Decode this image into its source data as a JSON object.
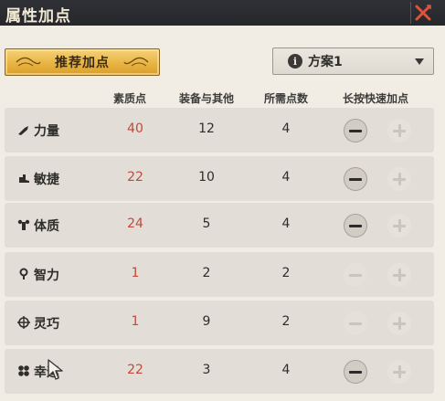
{
  "window": {
    "title": "属性加点",
    "close_icon": "close-icon"
  },
  "toolbar": {
    "recommend_label": "推荐加点",
    "scheme_label": "方案1",
    "scheme_info_glyph": "i"
  },
  "columns": {
    "base": "素质点",
    "equip": "装备与其他",
    "need": "所需点数",
    "quick_add": "长按快速加点"
  },
  "attributes": [
    {
      "name": "力量",
      "icon": "strength-icon",
      "base": "40",
      "equip": "12",
      "need": "4",
      "minus_enabled": true
    },
    {
      "name": "敏捷",
      "icon": "agility-icon",
      "base": "22",
      "equip": "10",
      "need": "4",
      "minus_enabled": true
    },
    {
      "name": "体质",
      "icon": "constitution-icon",
      "base": "24",
      "equip": "5",
      "need": "4",
      "minus_enabled": true
    },
    {
      "name": "智力",
      "icon": "intelligence-icon",
      "base": "1",
      "equip": "2",
      "need": "2",
      "minus_enabled": false
    },
    {
      "name": "灵巧",
      "icon": "dexterity-icon",
      "base": "1",
      "equip": "9",
      "need": "2",
      "minus_enabled": false
    },
    {
      "name": "幸运",
      "icon": "luck-icon",
      "base": "22",
      "equip": "3",
      "need": "4",
      "minus_enabled": true
    }
  ],
  "colors": {
    "base_value": "#c0493a",
    "title_bar": "#2f3136",
    "close_accent": "#e0533a",
    "gold_button": "#e9b443"
  }
}
